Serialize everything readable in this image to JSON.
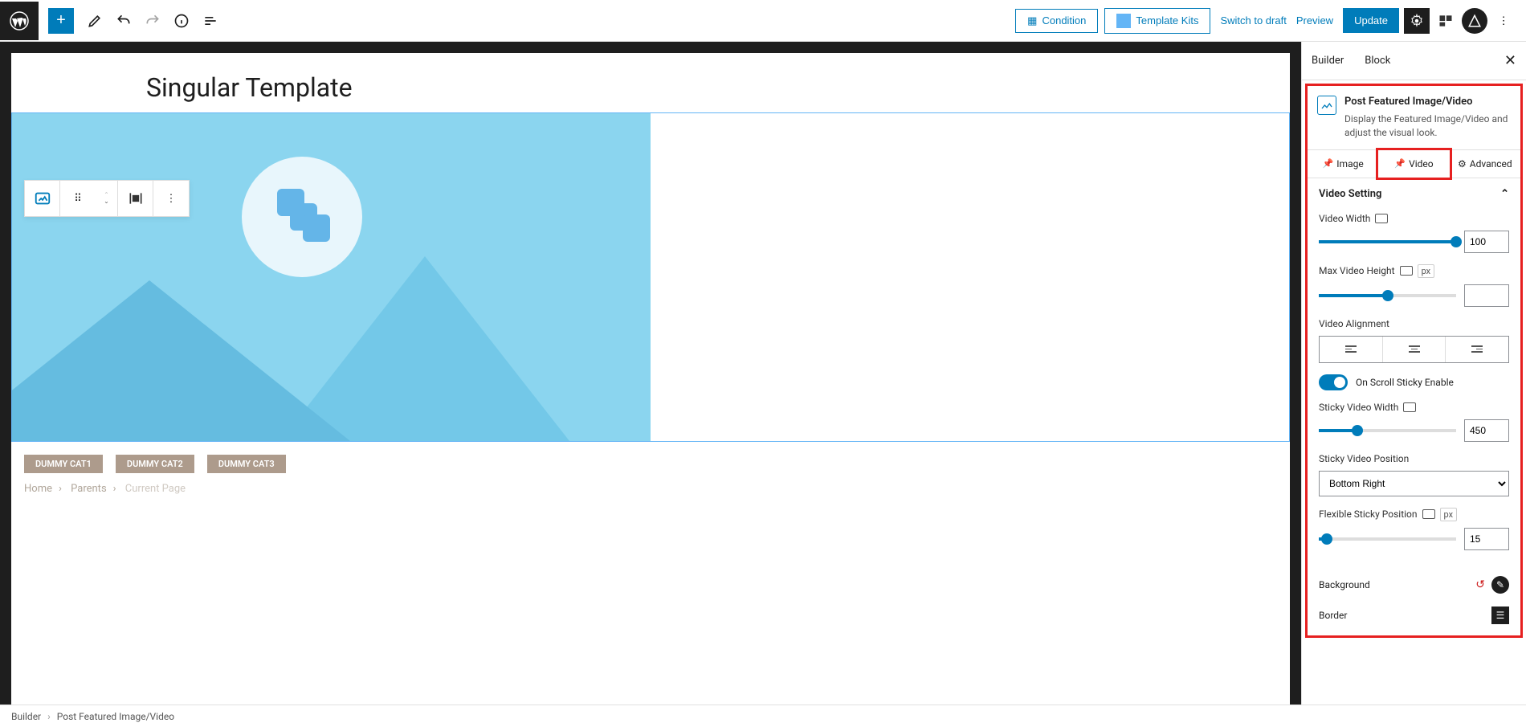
{
  "topbar": {
    "condition": "Condition",
    "template_kits": "Template Kits",
    "switch_draft": "Switch to draft",
    "preview": "Preview",
    "update": "Update"
  },
  "page": {
    "title": "Singular Template"
  },
  "cats": [
    "DUMMY CAT1",
    "DUMMY CAT2",
    "DUMMY CAT3"
  ],
  "breadcrumb": {
    "home": "Home",
    "parents": "Parents",
    "current": "Current Page"
  },
  "sidebar": {
    "tabs": {
      "builder": "Builder",
      "block": "Block"
    },
    "block_info": {
      "title": "Post Featured Image/Video",
      "desc": "Display the Featured Image/Video and adjust the visual look."
    },
    "subtabs": {
      "image": "Image",
      "video": "Video",
      "advanced": "Advanced"
    },
    "panel_title": "Video Setting",
    "fields": {
      "video_width": {
        "label": "Video Width",
        "value": "100"
      },
      "max_height": {
        "label": "Max Video Height",
        "unit": "px",
        "value": ""
      },
      "alignment": {
        "label": "Video Alignment"
      },
      "sticky_enable": {
        "label": "On Scroll Sticky Enable"
      },
      "sticky_width": {
        "label": "Sticky Video Width",
        "value": "450"
      },
      "sticky_position": {
        "label": "Sticky Video Position",
        "value": "Bottom Right"
      },
      "flexible_position": {
        "label": "Flexible Sticky Position",
        "unit": "px",
        "value": "15"
      },
      "background": "Background",
      "border": "Border"
    }
  },
  "footer": {
    "builder": "Builder",
    "block": "Post Featured Image/Video"
  }
}
